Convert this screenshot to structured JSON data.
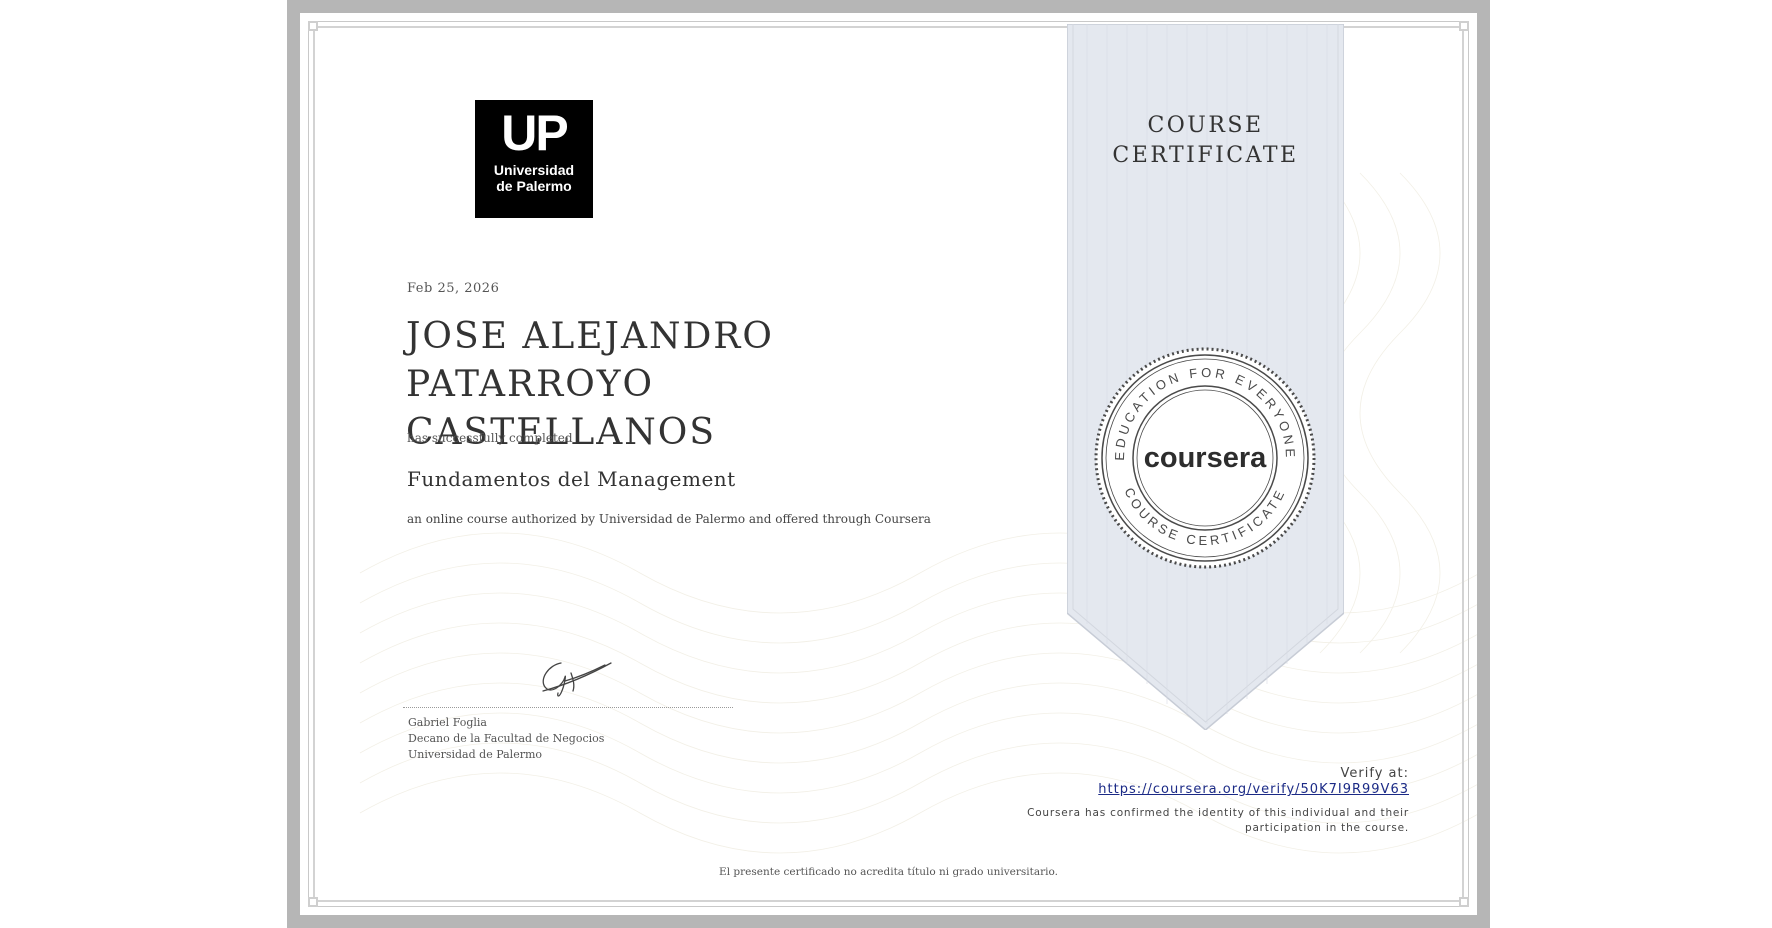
{
  "logo": {
    "initials": "UP",
    "line1": "Universidad",
    "line2": "de Palermo"
  },
  "certificate": {
    "date": "Feb 25, 2026",
    "recipient_line1": "JOSE ALEJANDRO PATARROYO",
    "recipient_line2": "CASTELLANOS",
    "completed_text": "has successfully completed",
    "course_name": "Fundamentos del Management",
    "authorized_text": "an online course authorized by Universidad de Palermo and offered through Coursera"
  },
  "signatory": {
    "name": "Gabriel Foglia",
    "title": "Decano de la Facultad de Negocios",
    "institution": "Universidad de Palermo"
  },
  "banner": {
    "title_line1": "COURSE",
    "title_line2": "CERTIFICATE"
  },
  "seal": {
    "top_text": "EDUCATION FOR EVERYONE",
    "bottom_text": "COURSE CERTIFICATE",
    "brand": "coursera"
  },
  "verification": {
    "label": "Verify at:",
    "url": "https://coursera.org/verify/50K7I9R99V63",
    "note_line1": "Coursera has confirmed the identity of this individual and their",
    "note_line2": "participation in the course."
  },
  "disclaimer": "El presente certificado no acredita título ni grado universitario.",
  "colors": {
    "banner_fill": "#e4e8ef",
    "seal_ink": "#4a4a4a",
    "link": "#1b2a86",
    "border": "#b6b6b6"
  }
}
